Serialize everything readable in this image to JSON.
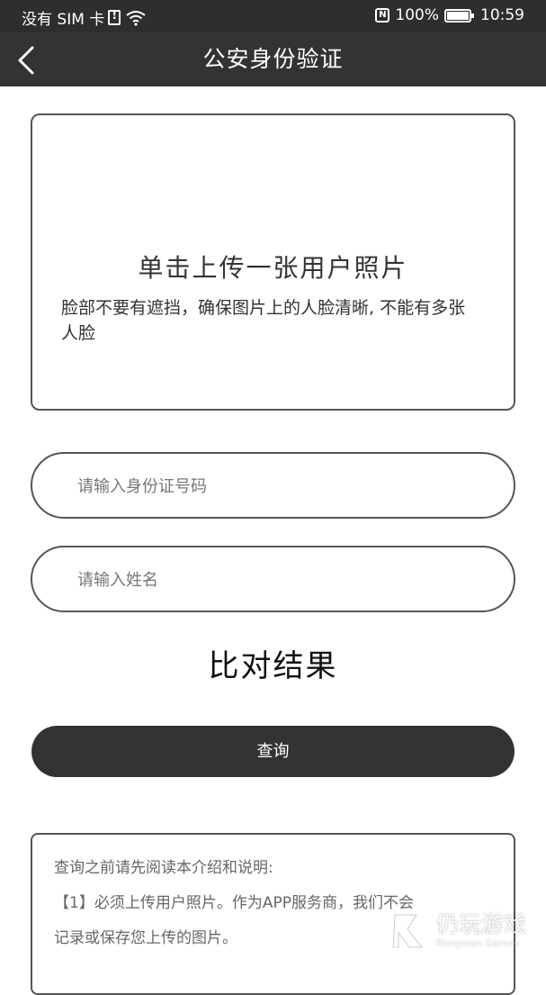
{
  "status_bar": {
    "carrier": "没有 SIM 卡",
    "battery": "100%",
    "time": "10:59"
  },
  "nav": {
    "title": "公安身份验证"
  },
  "upload": {
    "title": "单击上传一张用户照片",
    "hint": "脸部不要有遮挡，确保图片上的人脸清晰, 不能有多张人脸"
  },
  "form": {
    "id_placeholder": "请输入身份证号码",
    "id_value": "",
    "name_placeholder": "请输入姓名",
    "name_value": ""
  },
  "result": {
    "label": "比对结果"
  },
  "actions": {
    "query_label": "查询"
  },
  "notice": {
    "lines": [
      "查询之前请先阅读本介绍和说明:",
      "【1】必须上传用户照片。作为APP服务商，我们不会",
      "记录或保存您上传的图片。"
    ]
  },
  "watermark": {
    "title": "仍玩游戏",
    "subtitle": "Rengwan Games"
  },
  "colors": {
    "nav_bg": "#333333",
    "status_bg": "#2e2e2e",
    "button_bg": "#333333",
    "border": "#555555"
  }
}
